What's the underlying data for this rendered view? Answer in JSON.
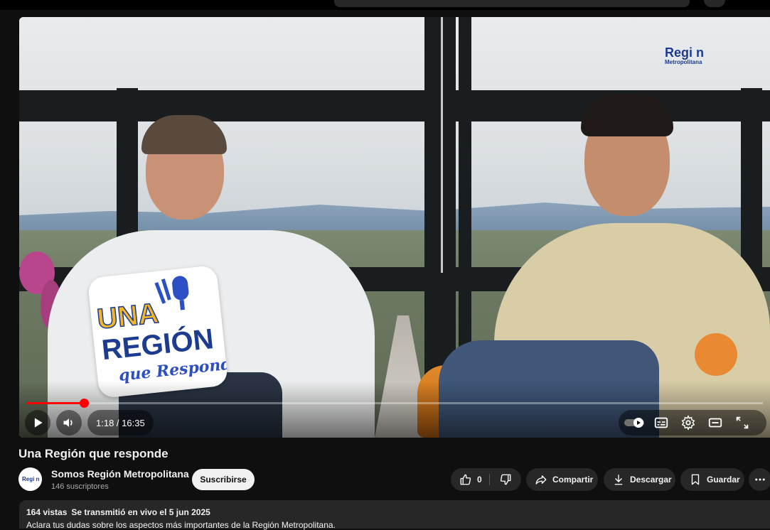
{
  "video": {
    "current_time": "1:18",
    "separator": " / ",
    "duration": "16:35",
    "progress": 0.0784,
    "overlay_logo": {
      "line1": "UNA",
      "line2": "REGIÓN",
      "line3": "que Responde"
    },
    "watermark": {
      "line1": "Regi n",
      "line2": "Metropolitana"
    }
  },
  "title": "Una Región que responde",
  "channel": {
    "name": "Somos Región Metropolitana",
    "subscribers": "146 suscriptores",
    "avatar_text": "Regi n",
    "subscribe_label": "Suscribirse"
  },
  "actions": {
    "likes": "0",
    "share_label": "Compartir",
    "download_label": "Descargar",
    "save_label": "Guardar"
  },
  "description": {
    "views": "164 vistas",
    "date": "Se transmitió en vivo el 5 jun 2025",
    "text": "Aclara tus dudas sobre los aspectos más importantes de la Región Metropolitana."
  },
  "colors": {
    "accent": "#ff0000",
    "background": "#0f0f0f",
    "pill": "#272727"
  }
}
